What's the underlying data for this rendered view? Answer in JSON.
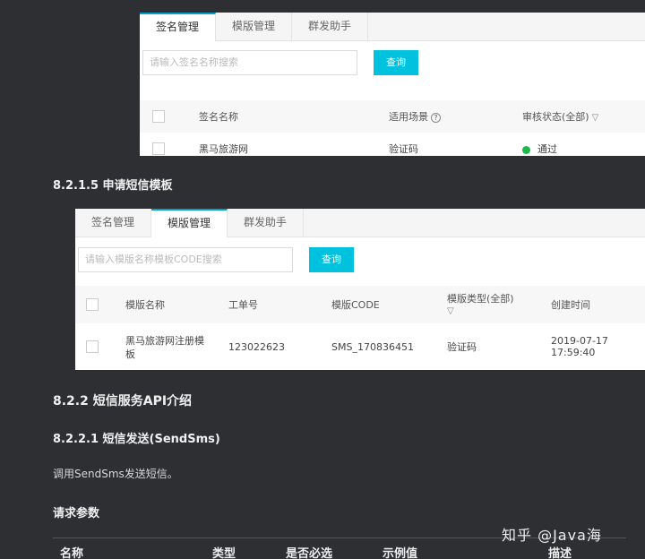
{
  "panel1": {
    "tabs": [
      "签名管理",
      "模版管理",
      "群发助手"
    ],
    "search_placeholder": "请输入签名名称搜索",
    "query_label": "查询",
    "headers": {
      "name": "签名名称",
      "scene": "适用场景",
      "status": "审核状态(全部)"
    },
    "row": {
      "name": "黑马旅游网",
      "scene": "验证码",
      "status": "通过"
    }
  },
  "section_8215": "8.2.1.5 申请短信模板",
  "panel2": {
    "tabs": [
      "签名管理",
      "模版管理",
      "群发助手"
    ],
    "search_placeholder": "请输入模版名称模板CODE搜索",
    "query_label": "查询",
    "headers": {
      "name": "模版名称",
      "order": "工单号",
      "code": "模版CODE",
      "type": "模版类型(全部)",
      "created": "创建时间"
    },
    "row": {
      "name": "黑马旅游网注册模板",
      "order": "123022623",
      "code": "SMS_170836451",
      "type": "验证码",
      "created": "2019-07-17 17:59:40"
    }
  },
  "section_822": "8.2.2 短信服务API介绍",
  "section_8221": "8.2.2.1 短信发送(SendSms)",
  "description": "调用SendSms发送短信。",
  "request_params_title": "请求参数",
  "param_table_headers": [
    "名称",
    "类型",
    "是否必选",
    "示例值",
    "描述"
  ],
  "watermark": "知乎 @Java海"
}
